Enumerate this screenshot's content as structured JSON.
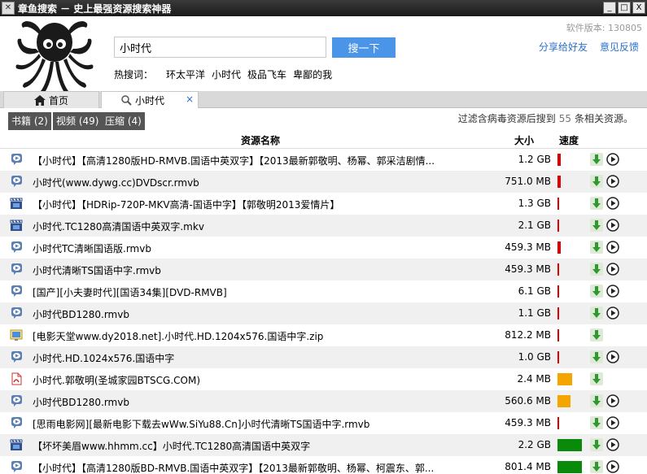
{
  "window": {
    "title": "章鱼搜索 － 史上最强资源搜索神器",
    "minimize": "_",
    "maximize": "□",
    "close": "X"
  },
  "header": {
    "search_value": "小时代",
    "search_button": "搜一下",
    "hot_label": "热搜词：",
    "hot_words": [
      "环太平洋",
      "小时代",
      "极品飞车",
      "卑鄙的我"
    ],
    "version": "软件版本: 130805",
    "share": "分享给好友",
    "feedback": "意见反馈"
  },
  "tabs": {
    "home": "首页",
    "search": "小时代",
    "close": "×"
  },
  "filters": [
    {
      "label": "书籍 (2)"
    },
    {
      "label": "视频 (49)"
    },
    {
      "label": "压缩 (4)"
    }
  ],
  "summary": {
    "prefix": "过滤含病毒资源后搜到",
    "count": "55",
    "suffix": "条相关资源。"
  },
  "columns": {
    "name": "资源名称",
    "size": "大小",
    "speed": "速度"
  },
  "colors": {
    "speed_low": "#e00000",
    "speed_mid": "#f5a500",
    "speed_high": "#0a8a0a",
    "accent": "#4b95e8"
  },
  "rows": [
    {
      "icon": "video-file-icon",
      "name": "【小时代】【高清1280版HD-RMVB.国语中英双字】【2013最新郭敬明、杨幂、郭采洁剧情...",
      "size": "1.2 GB",
      "speed": 3,
      "play": true
    },
    {
      "icon": "video-file-icon",
      "name": "小时代(www.dywg.cc)DVDscr.rmvb",
      "size": "751.0 MB",
      "speed": 3,
      "play": true
    },
    {
      "icon": "movie-clapper-icon",
      "name": "【小时代】【HDRip-720P-MKV高清-国语中字】【郭敬明2013爱情片】",
      "size": "1.3 GB",
      "speed": 1,
      "play": true
    },
    {
      "icon": "movie-clapper-icon",
      "name": "小时代.TC1280高清国语中英双字.mkv",
      "size": "2.1 GB",
      "speed": 1,
      "play": true
    },
    {
      "icon": "video-file-icon",
      "name": "小时代TC清晰国语版.rmvb",
      "size": "459.3 MB",
      "speed": 3,
      "play": true
    },
    {
      "icon": "video-file-icon",
      "name": "小时代清晰TS国语中字.rmvb",
      "size": "459.3 MB",
      "speed": 1,
      "play": true
    },
    {
      "icon": "video-file-icon",
      "name": "[国产][小夫妻时代][国语34集][DVD-RMVB]",
      "size": "6.1 GB",
      "speed": 1,
      "play": true
    },
    {
      "icon": "video-file-icon",
      "name": "小时代BD1280.rmvb",
      "size": "1.1 GB",
      "speed": 1,
      "play": true
    },
    {
      "icon": "zip-file-icon",
      "name": "[电影天堂www.dy2018.net].小时代.HD.1204x576.国语中字.zip",
      "size": "812.2 MB",
      "speed": 1,
      "play": false
    },
    {
      "icon": "video-file-icon",
      "name": "小时代.HD.1024x576.国语中字",
      "size": "1.0 GB",
      "speed": 1,
      "play": true
    },
    {
      "icon": "pdf-file-icon",
      "name": "小时代.郭敬明(圣城家园BTSCG.COM)",
      "size": "2.4 MB",
      "speed": 18,
      "play": false
    },
    {
      "icon": "video-file-icon",
      "name": "小时代BD1280.rmvb",
      "size": "560.6 MB",
      "speed": 16,
      "play": true
    },
    {
      "icon": "video-file-icon",
      "name": "[思雨电影网][最新电影下载去wWw.SiYu88.Cn]小时代清晰TS国语中字.rmvb",
      "size": "459.3 MB",
      "speed": 1,
      "play": true
    },
    {
      "icon": "movie-clapper-icon",
      "name": "【坏坏美眉www.hhmm.cc】小时代.TC1280高清国语中英双字",
      "size": "2.2 GB",
      "speed": 30,
      "play": true
    },
    {
      "icon": "video-file-icon",
      "name": "【小时代】【高清1280版BD-RMVB.国语中英双字】【2013最新郭敬明、杨幂、柯震东、郭...",
      "size": "801.4 MB",
      "speed": 30,
      "play": true
    }
  ]
}
